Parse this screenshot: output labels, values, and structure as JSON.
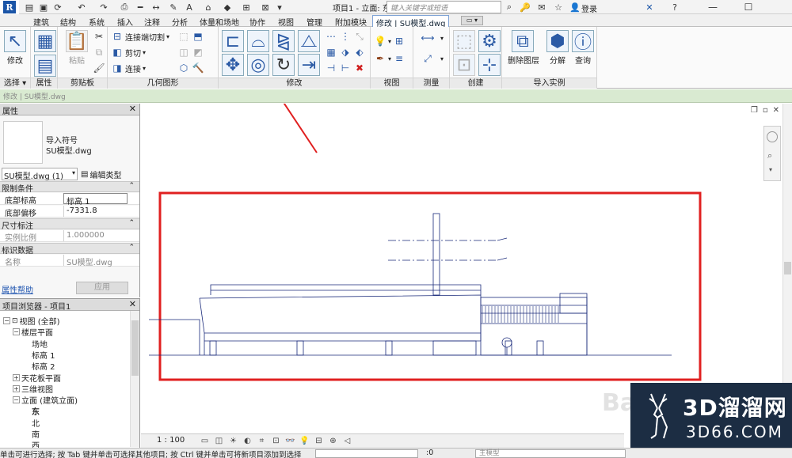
{
  "app": {
    "logo": "R",
    "title": "项目1 - 立面: 东"
  },
  "search": {
    "placeholder": "键入关键字或短语"
  },
  "user": {
    "login": "登录"
  },
  "window": {
    "minimize": "—",
    "maximize": "☐"
  },
  "tabs": [
    "建筑",
    "结构",
    "系统",
    "插入",
    "注释",
    "分析",
    "体量和场地",
    "协作",
    "视图",
    "管理",
    "附加模块",
    "修改 | SU模型.dwg"
  ],
  "active_tab": "修改 | SU模型.dwg",
  "ribbon": {
    "select": {
      "modify_label": "修改",
      "panel": "选择 ▾"
    },
    "properties_panel": "属性",
    "clipboard": {
      "paste": "粘贴",
      "panel": "剪贴板"
    },
    "geometry": {
      "join_cut": "连接端切割",
      "cut": "剪切",
      "join": "连接",
      "panel": "几何图形"
    },
    "modify": {
      "panel": "修改"
    },
    "view": {
      "panel": "视图"
    },
    "measure": {
      "panel": "测量"
    },
    "create": {
      "panel": "创建"
    },
    "import_instance": {
      "delete_layers": "删除图层",
      "explode": "分解",
      "query": "查询",
      "panel": "导入实例"
    }
  },
  "infostrip": {
    "text": "修改 | SU模型.dwg"
  },
  "properties": {
    "header": "属性",
    "type_line1": "导入符号",
    "type_line2": "SU模型.dwg",
    "selector": "SU模型.dwg (1)",
    "edit_type": "编辑类型",
    "sections": [
      {
        "name": "限制条件",
        "rows": [
          {
            "k": "底部标高",
            "v": "标高 1",
            "boxed": true
          },
          {
            "k": "底部偏移",
            "v": "-7331.8"
          }
        ]
      },
      {
        "name": "尺寸标注",
        "rows": [
          {
            "k": "实例比例",
            "v": "1.000000",
            "dim": true
          }
        ]
      },
      {
        "name": "标识数据",
        "rows": [
          {
            "k": "名称",
            "v": "SU模型.dwg",
            "dim": true
          }
        ]
      }
    ],
    "help": "属性帮助",
    "apply": "应用"
  },
  "browser": {
    "header": "项目浏览器 - 项目1",
    "nodes": [
      {
        "label": "视图 (全部)",
        "indent": 0,
        "toggle": "−",
        "icon": true
      },
      {
        "label": "楼层平面",
        "indent": 1,
        "toggle": "−"
      },
      {
        "label": "场地",
        "indent": 2
      },
      {
        "label": "标高 1",
        "indent": 2
      },
      {
        "label": "标高 2",
        "indent": 2
      },
      {
        "label": "天花板平面",
        "indent": 1,
        "toggle": "+"
      },
      {
        "label": "三维视图",
        "indent": 1,
        "toggle": "+"
      },
      {
        "label": "立面 (建筑立面)",
        "indent": 1,
        "toggle": "−"
      },
      {
        "label": "东",
        "indent": 2,
        "bold": true
      },
      {
        "label": "北",
        "indent": 2
      },
      {
        "label": "南",
        "indent": 2
      },
      {
        "label": "西",
        "indent": 2
      }
    ]
  },
  "viewbar": {
    "scale": "1 : 100"
  },
  "status": {
    "text": "单击可进行选择; 按 Tab 键并单击可选择其他项目; 按 Ctrl 键并单击可将新项目添加到选择",
    "count": ":0",
    "model": "主模型"
  },
  "watermark": {
    "main": "3D溜溜网",
    "sub": "3D66.COM",
    "ghost": "Ba"
  },
  "colors": {
    "accent": "#1b55a7",
    "annotation": "#e02020",
    "drawing": "#1a2a7a"
  }
}
